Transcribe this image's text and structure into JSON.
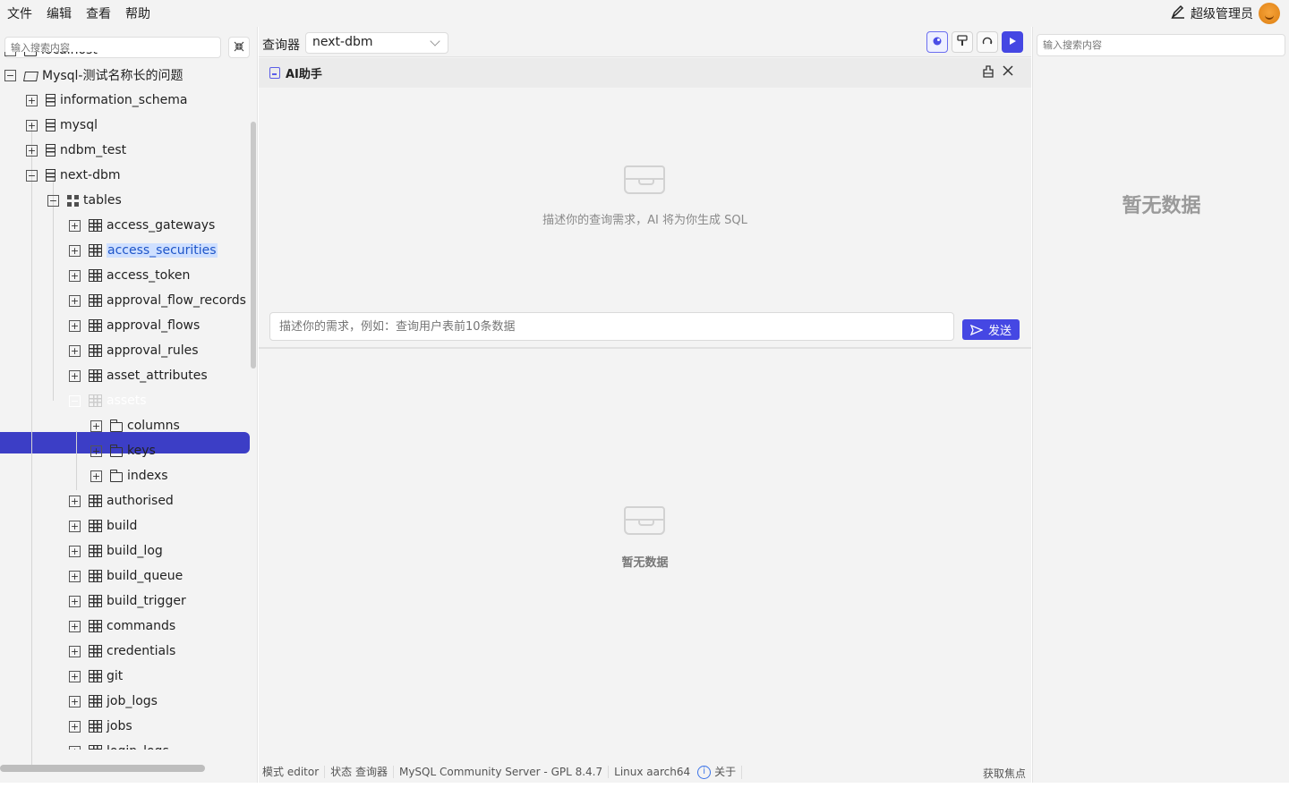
{
  "menubar": {
    "items": [
      "文件",
      "编辑",
      "查看",
      "帮助"
    ],
    "user_name": "超级管理员",
    "user_icon": "person-edit-icon"
  },
  "sidebar": {
    "search_placeholder": "输入搜索内容",
    "collapse_icon": "collapse-all-icon",
    "tree": [
      {
        "label": "localhost",
        "level": 0,
        "expanded": true,
        "icon": "server-icon",
        "partial": true
      },
      {
        "label": "Mysql-测试名称长的问题",
        "level": 0,
        "expanded": true,
        "icon": "folder-open-icon"
      },
      {
        "label": "information_schema",
        "level": 1,
        "expanded": false,
        "icon": "database-icon"
      },
      {
        "label": "mysql",
        "level": 1,
        "expanded": false,
        "icon": "database-icon"
      },
      {
        "label": "ndbm_test",
        "level": 1,
        "expanded": false,
        "icon": "database-icon"
      },
      {
        "label": "next-dbm",
        "level": 1,
        "expanded": true,
        "icon": "database-icon"
      },
      {
        "label": "tables",
        "level": 2,
        "expanded": true,
        "icon": "grid-icon"
      },
      {
        "label": "access_gateways",
        "level": 3,
        "expanded": false,
        "icon": "table-icon"
      },
      {
        "label": "access_securities",
        "level": 3,
        "expanded": false,
        "icon": "table-icon",
        "highlighted": true
      },
      {
        "label": "access_token",
        "level": 3,
        "expanded": false,
        "icon": "table-icon"
      },
      {
        "label": "approval_flow_records",
        "level": 3,
        "expanded": false,
        "icon": "table-icon"
      },
      {
        "label": "approval_flows",
        "level": 3,
        "expanded": false,
        "icon": "table-icon"
      },
      {
        "label": "approval_rules",
        "level": 3,
        "expanded": false,
        "icon": "table-icon"
      },
      {
        "label": "asset_attributes",
        "level": 3,
        "expanded": false,
        "icon": "table-icon"
      },
      {
        "label": "assets",
        "level": 3,
        "expanded": true,
        "icon": "table-icon",
        "selected": true
      },
      {
        "label": "columns",
        "level": 4,
        "expanded": false,
        "icon": "folder-icon"
      },
      {
        "label": "keys",
        "level": 4,
        "expanded": false,
        "icon": "folder-icon"
      },
      {
        "label": "indexs",
        "level": 4,
        "expanded": false,
        "icon": "folder-icon"
      },
      {
        "label": "authorised",
        "level": 3,
        "expanded": false,
        "icon": "table-icon"
      },
      {
        "label": "build",
        "level": 3,
        "expanded": false,
        "icon": "table-icon"
      },
      {
        "label": "build_log",
        "level": 3,
        "expanded": false,
        "icon": "table-icon"
      },
      {
        "label": "build_queue",
        "level": 3,
        "expanded": false,
        "icon": "table-icon"
      },
      {
        "label": "build_trigger",
        "level": 3,
        "expanded": false,
        "icon": "table-icon"
      },
      {
        "label": "commands",
        "level": 3,
        "expanded": false,
        "icon": "table-icon"
      },
      {
        "label": "credentials",
        "level": 3,
        "expanded": false,
        "icon": "table-icon"
      },
      {
        "label": "git",
        "level": 3,
        "expanded": false,
        "icon": "table-icon"
      },
      {
        "label": "job_logs",
        "level": 3,
        "expanded": false,
        "icon": "table-icon"
      },
      {
        "label": "jobs",
        "level": 3,
        "expanded": false,
        "icon": "table-icon"
      },
      {
        "label": "login_logs",
        "level": 3,
        "expanded": false,
        "icon": "table-icon",
        "partial": true
      }
    ]
  },
  "toolbar": {
    "label": "查询器",
    "db_selected": "next-dbm",
    "buttons": [
      {
        "icon": "ai-assistant-icon",
        "active": true
      },
      {
        "icon": "format-paint-icon"
      },
      {
        "icon": "refresh-icon"
      },
      {
        "icon": "play-icon",
        "primary": true
      }
    ]
  },
  "ai_panel": {
    "title": "AI助手",
    "empty_text": "描述你的查询需求，AI 将为你生成 SQL",
    "input_placeholder": "描述你的需求，例如：查询用户表前10条数据",
    "send_label": "发送"
  },
  "results": {
    "empty_text": "暂无数据"
  },
  "statusbar": {
    "mode": "模式 editor",
    "state": "状态 查询器",
    "server": "MySQL Community Server - GPL 8.4.7",
    "os": "Linux aarch64",
    "about": "关于",
    "focus": "获取焦点"
  },
  "rightpanel": {
    "search_placeholder": "输入搜索内容",
    "empty_text": "暂无数据"
  },
  "colors": {
    "accent": "#4547e3",
    "selected_row": "#3c3ec6",
    "highlight_text": "#1e55c8",
    "panel_bg": "#f3f3f3"
  }
}
